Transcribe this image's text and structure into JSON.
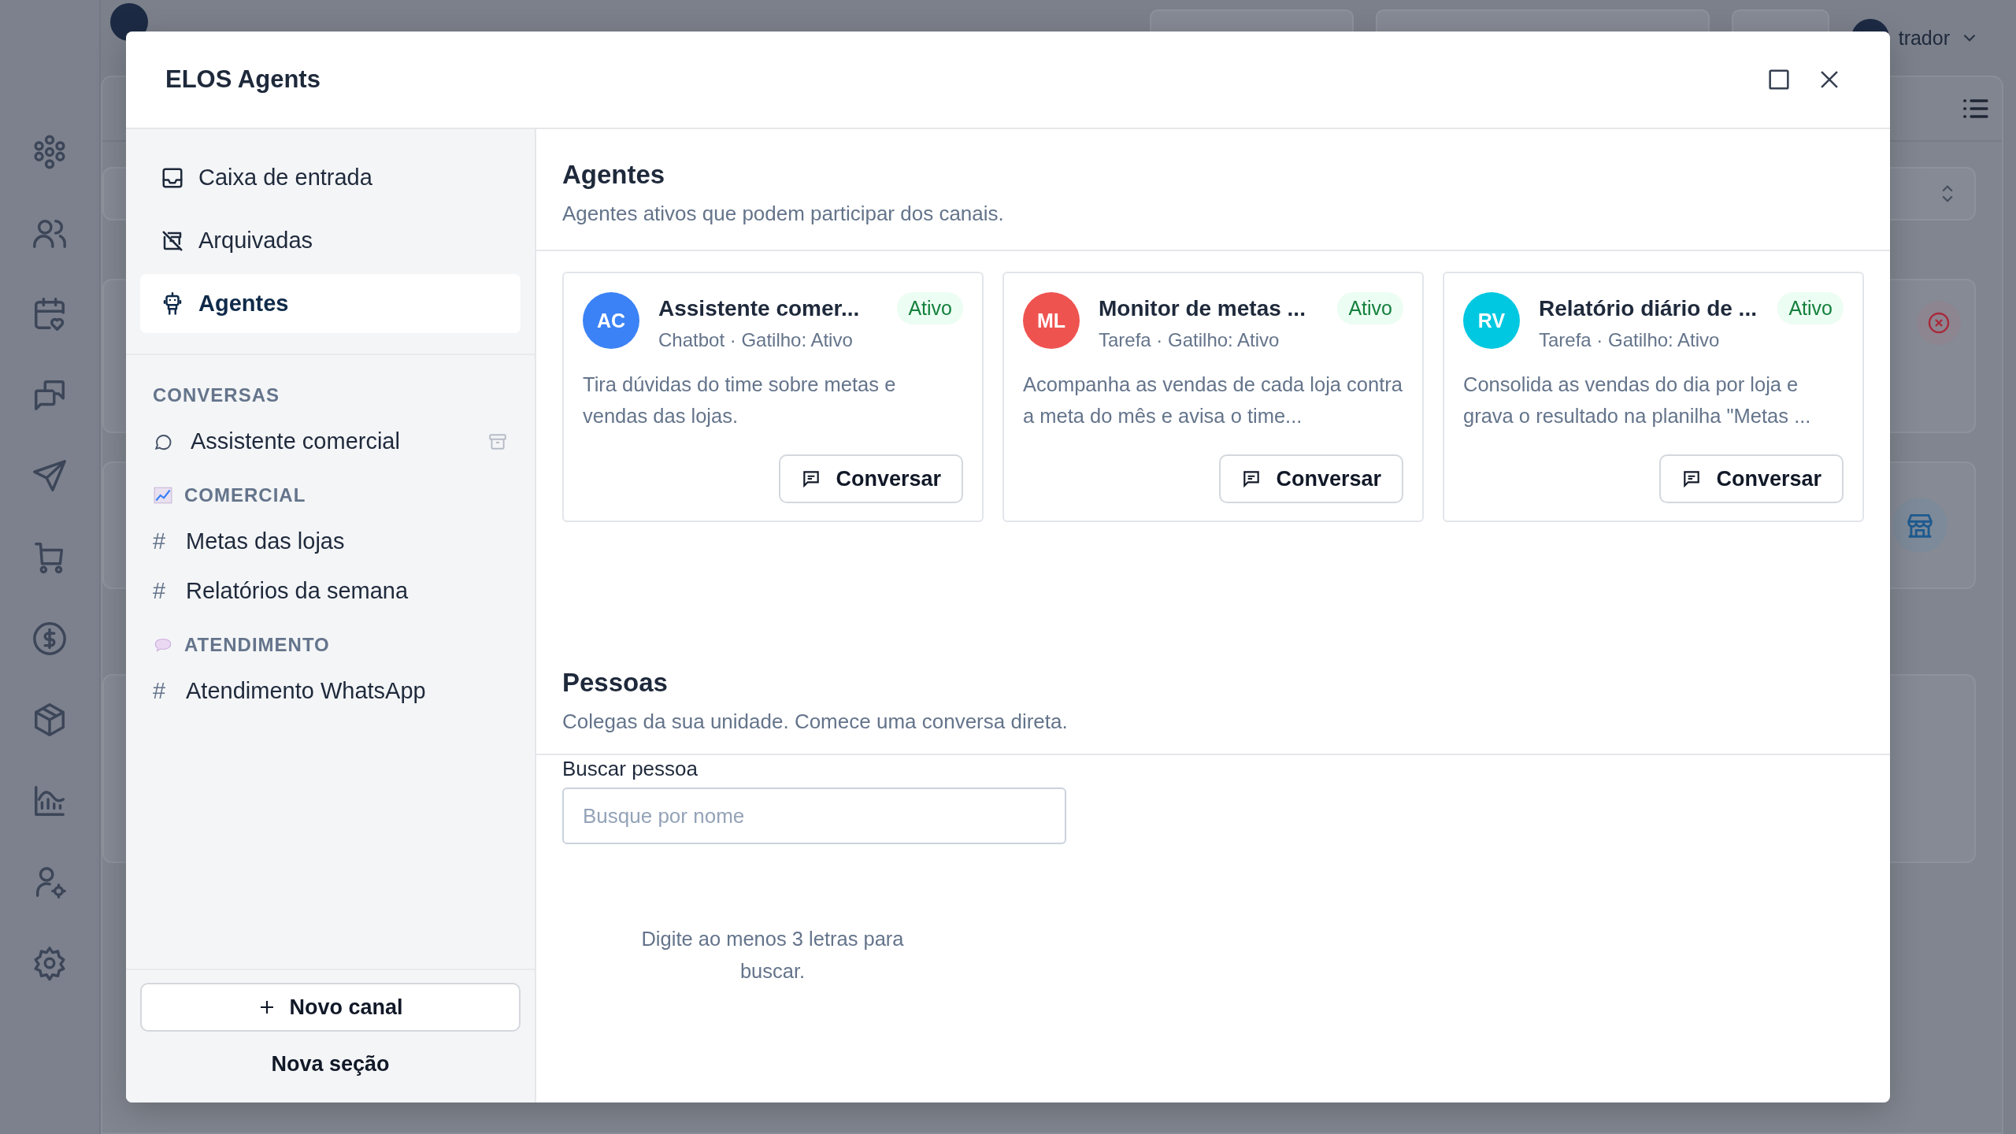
{
  "background": {
    "user_name": "trador"
  },
  "window": {
    "title": "ELOS Agents"
  },
  "sidebar": {
    "nav": [
      {
        "label": "Caixa de entrada",
        "selected": false
      },
      {
        "label": "Arquivadas",
        "selected": false
      },
      {
        "label": "Agentes",
        "selected": true
      }
    ],
    "conversations": {
      "heading": "CONVERSAS",
      "items": [
        {
          "label": "Assistente comercial"
        }
      ]
    },
    "groups": [
      {
        "heading": "COMERCIAL",
        "channels": [
          {
            "prefix": "#",
            "label": "Metas das lojas"
          },
          {
            "prefix": "#",
            "label": "Relatórios da semana"
          }
        ]
      },
      {
        "heading": "ATENDIMENTO",
        "channels": [
          {
            "prefix": "#",
            "label": "Atendimento WhatsApp"
          }
        ]
      }
    ],
    "new_channel_button": "Novo canal",
    "new_section_link": "Nova seção"
  },
  "agents": {
    "title": "Agentes",
    "subtitle": "Agentes ativos que podem participar dos canais.",
    "cards": [
      {
        "initials": "AC",
        "color": "#3b82f6",
        "name": "Assistente comer...",
        "status": "Ativo",
        "meta": "Chatbot · Gatilho: Ativo",
        "description": "Tira dúvidas do time sobre metas e vendas das lojas.",
        "button": "Conversar"
      },
      {
        "initials": "ML",
        "color": "#ef5350",
        "name": "Monitor de metas ...",
        "status": "Ativo",
        "meta": "Tarefa · Gatilho: Ativo",
        "description": "Acompanha as vendas de cada loja contra a meta do mês e avisa o time...",
        "button": "Conversar"
      },
      {
        "initials": "RV",
        "color": "#00c8e0",
        "name": "Relatório diário de ...",
        "status": "Ativo",
        "meta": "Tarefa · Gatilho: Ativo",
        "description": "Consolida as vendas do dia por loja e grava o resultado na planilha \"Metas ...",
        "button": "Conversar"
      }
    ]
  },
  "people": {
    "title": "Pessoas",
    "subtitle": "Colegas da sua unidade. Comece uma conversa direta.",
    "search_label": "Buscar pessoa",
    "search_placeholder": "Busque por nome",
    "hint": "Digite ao menos 3 letras para buscar."
  }
}
